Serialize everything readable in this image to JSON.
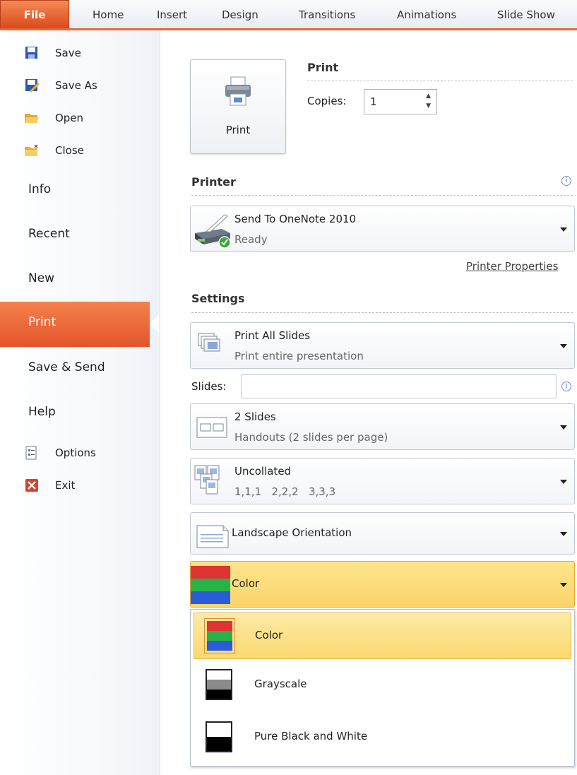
{
  "ribbon": {
    "file": "File",
    "tabs": [
      "Home",
      "Insert",
      "Design",
      "Transitions",
      "Animations",
      "Slide Show"
    ]
  },
  "backstage": {
    "commands": {
      "save": "Save",
      "save_as": "Save As",
      "open": "Open",
      "close": "Close"
    },
    "nav": {
      "info": "Info",
      "recent": "Recent",
      "new": "New",
      "print": "Print",
      "save_send": "Save & Send",
      "help": "Help"
    },
    "bottom": {
      "options": "Options",
      "exit": "Exit"
    }
  },
  "print": {
    "button_label": "Print",
    "heading": "Print",
    "copies_label": "Copies:",
    "copies_value": "1"
  },
  "printer": {
    "heading": "Printer",
    "name": "Send To OneNote 2010",
    "status": "Ready",
    "properties_link": "Printer Properties"
  },
  "settings": {
    "heading": "Settings",
    "range_title": "Print All Slides",
    "range_sub": "Print entire presentation",
    "slides_label": "Slides:",
    "slides_value": "",
    "layout_title": "2 Slides",
    "layout_sub": "Handouts (2 slides per page)",
    "collate_title": "Uncollated",
    "collate_sub": "1,1,1   2,2,2   3,3,3",
    "orientation": "Landscape Orientation",
    "color": "Color"
  },
  "color_menu": {
    "items": [
      "Color",
      "Grayscale",
      "Pure Black and White"
    ],
    "selected": "Color"
  },
  "colors": {
    "accent": "#e9672f",
    "highlight": "#fbd971"
  }
}
